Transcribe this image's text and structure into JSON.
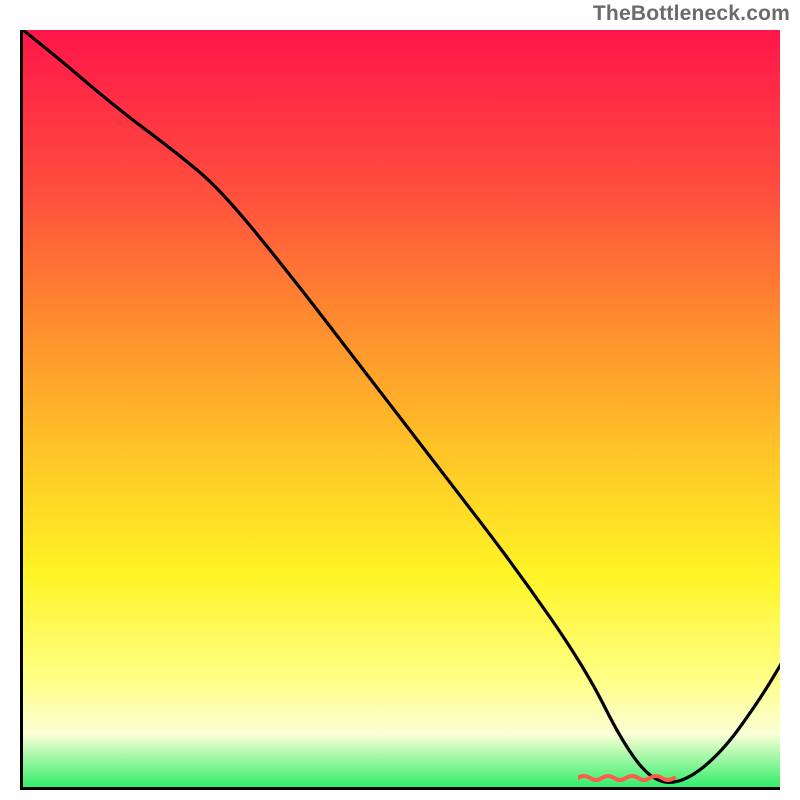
{
  "attribution": "TheBottleneck.com",
  "chart_data": {
    "type": "line",
    "title": "",
    "xlabel": "",
    "ylabel": "",
    "xlim": [
      0,
      100
    ],
    "ylim": [
      0,
      100
    ],
    "grid": false,
    "legend": false,
    "notes": "Background is a vertical red→yellow→green heat gradient; single black curve descends from top-left to a minimum near x≈83 then rises toward the right edge. A short red dashed marker sits at the valley floor.",
    "series": [
      {
        "name": "curve",
        "color": "#000000",
        "x": [
          0,
          5,
          12,
          20,
          26,
          35,
          45,
          55,
          65,
          74,
          79,
          83,
          87,
          92,
          97,
          100
        ],
        "y": [
          100,
          96,
          90,
          84,
          79,
          68,
          55,
          42,
          29,
          16,
          6,
          1,
          1,
          5,
          12,
          17
        ]
      }
    ],
    "annotations": [
      {
        "name": "valley-marker",
        "type": "dashed-segment",
        "color": "#ff5a4a",
        "x_range": [
          77,
          90
        ],
        "y": 1
      }
    ]
  }
}
